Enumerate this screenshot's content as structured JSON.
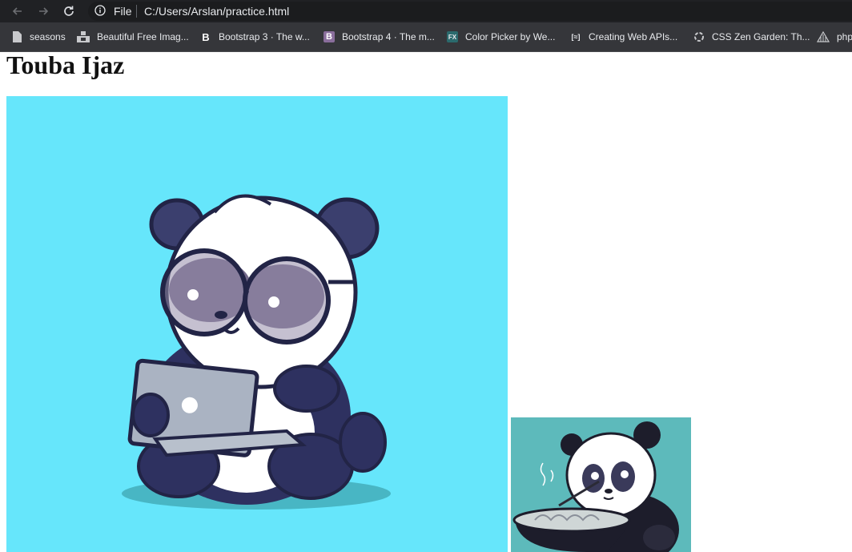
{
  "browser": {
    "file_label": "File",
    "url": "C:/Users/Arslan/practice.html"
  },
  "bookmarks": [
    {
      "label": "seasons",
      "icon": "document-icon"
    },
    {
      "label": "Beautiful Free Imag...",
      "icon": "unsplash-icon"
    },
    {
      "label": "Bootstrap 3 · The w...",
      "icon": "bootstrap-icon"
    },
    {
      "label": "Bootstrap 4 · The m...",
      "icon": "bootstrap-icon"
    },
    {
      "label": "Color Picker by We...",
      "icon": "fx-icon"
    },
    {
      "label": "Creating Web APIs...",
      "icon": "api-icon"
    },
    {
      "label": "CSS Zen Garden: Th...",
      "icon": "zen-icon"
    },
    {
      "label": "php",
      "icon": "php-icon"
    }
  ],
  "page": {
    "heading": "Touba Ijaz"
  },
  "colors": {
    "chrome_dark": "#202124",
    "bookmarks_bar": "#35363a",
    "image1_bg": "#66e6fb",
    "image2_bg": "#5dbabb",
    "panda_dark": "#2d3057"
  },
  "icons": {
    "back": "arrow-left-icon",
    "forward": "arrow-right-icon",
    "reload": "reload-icon",
    "info": "info-icon"
  }
}
